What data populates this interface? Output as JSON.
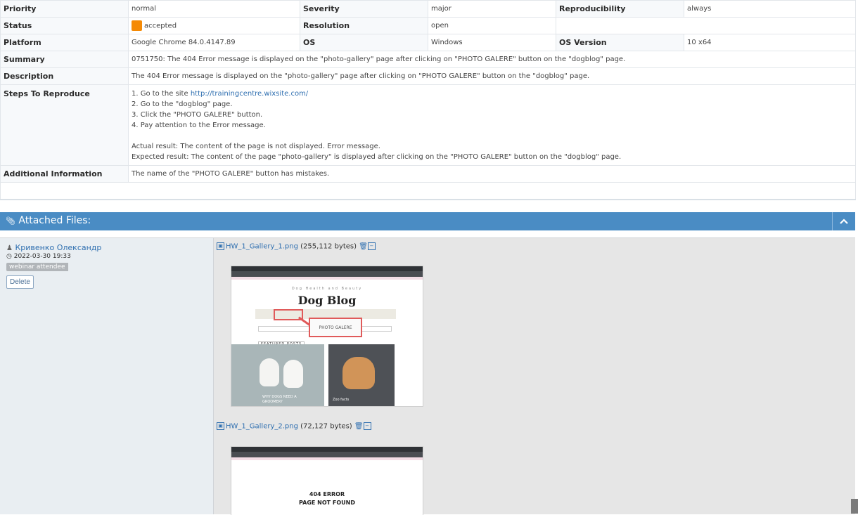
{
  "rows": {
    "priority": {
      "label": "Priority",
      "value": "normal"
    },
    "severity": {
      "label": "Severity",
      "value": "major"
    },
    "reproducibility": {
      "label": "Reproducibility",
      "value": "always"
    },
    "status": {
      "label": "Status",
      "value": "accepted"
    },
    "resolution": {
      "label": "Resolution",
      "value": "open"
    },
    "platform": {
      "label": "Platform",
      "value": "Google Chrome 84.0.4147.89"
    },
    "os": {
      "label": "OS",
      "value": "Windows"
    },
    "os_version": {
      "label": "OS Version",
      "value": "10 x64"
    },
    "summary": {
      "label": "Summary",
      "value": "0751750: The 404 Error message is displayed on the \"photo-gallery\" page after clicking on \"PHOTO GALERE\" button on the \"dogblog\" page."
    },
    "description": {
      "label": "Description",
      "value": "The 404 Error message is displayed on the \"photo-gallery\" page after clicking on \"PHOTO GALERE\" button on the \"dogblog\" page."
    },
    "steps": {
      "label": "Steps To Reproduce",
      "step1_prefix": "1. Go to the site ",
      "step1_link": "http://trainingcentre.wixsite.com/",
      "step2": "2. Go to the \"dogblog\" page.",
      "step3": "3. Click the \"PHOTO GALERE\" button.",
      "step4": "4. Pay attention to the Error message.",
      "actual": "Actual result: The content of the page is not displayed. Error message.",
      "expected": "Expected result: The content of the page \"photo-gallery\" is displayed after clicking on the \"PHOTO GALERE\" button on the \"dogblog\" page."
    },
    "additional": {
      "label": "Additional Information",
      "value": "The name of the \"PHOTO GALERE\" button has mistakes."
    }
  },
  "colors": {
    "status_accepted": "#f58a05",
    "header_blue": "#4a8cc4",
    "link": "#2f6fb0"
  },
  "attachments": {
    "title": "Attached Files:",
    "author": "Кривенко Олександр",
    "timestamp": "2022-03-30 19:33",
    "tag": "webinar attendee",
    "delete_label": "Delete",
    "files": [
      {
        "name": "HW_1_Gallery_1.png",
        "size": "(255,112 bytes)"
      },
      {
        "name": "HW_1_Gallery_2.png",
        "size": "(72,127 bytes)"
      }
    ],
    "thumb1": {
      "tagline": "Dog Health and Beauty",
      "title": "Dog Blog",
      "button": "PHOTO GALERE",
      "featured": "FEATURED POSTS",
      "caption1": "WHY DOGS NEED A GROOMER?",
      "caption2": "Zoo facts"
    },
    "thumb2": {
      "error_line1": "404 ERROR",
      "error_line2": "PAGE NOT FOUND"
    }
  }
}
